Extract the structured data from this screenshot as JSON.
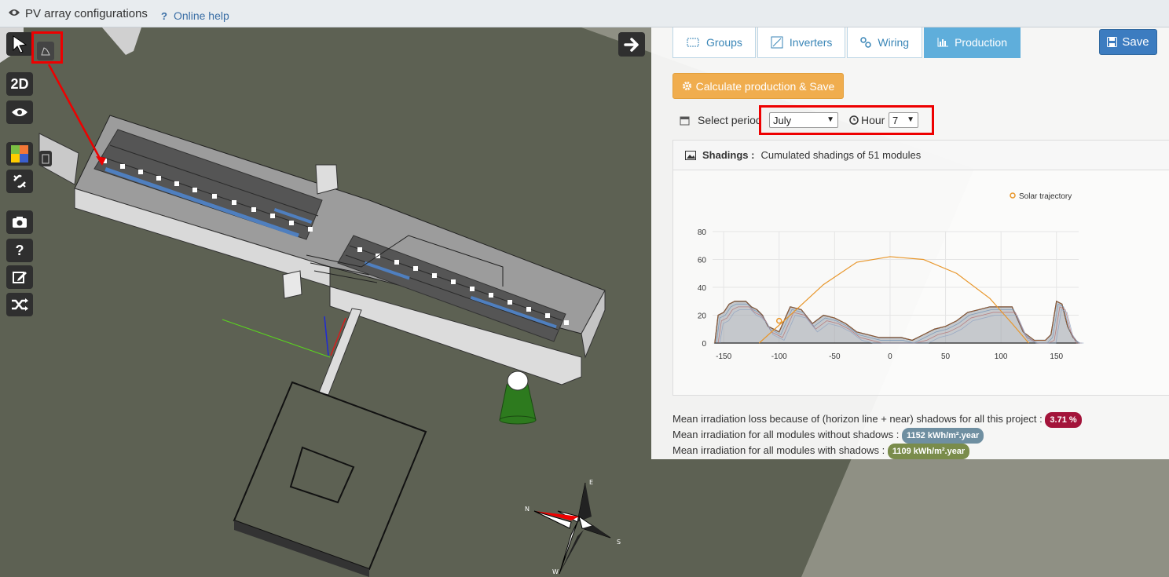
{
  "topbar": {
    "title": "PV array configurations",
    "help": "Online help"
  },
  "toolbar": {
    "mode_2d": "2D",
    "help_q": "?"
  },
  "tabs": [
    {
      "label": "Groups",
      "icon": "groups-icon"
    },
    {
      "label": "Inverters",
      "icon": "inverter-icon"
    },
    {
      "label": "Wiring",
      "icon": "wiring-icon"
    },
    {
      "label": "Production",
      "icon": "bar-chart-icon",
      "active": true
    }
  ],
  "save_label": "Save",
  "calc_label": "Calculate production & Save",
  "period": {
    "label": "Select period",
    "month": "July",
    "hour_label": "Hour",
    "hour": "7"
  },
  "shadings": {
    "title": "Shadings :",
    "subtitle": "Cumulated shadings of 51 modules"
  },
  "chart_data": {
    "type": "area",
    "series": [
      {
        "name": "Solar trajectory",
        "color": "#e8962a"
      }
    ],
    "solar_trajectory": {
      "x": [
        -118,
        -90,
        -60,
        -30,
        0,
        30,
        60,
        90,
        110,
        125
      ],
      "y": [
        0,
        20,
        42,
        58,
        62,
        60,
        50,
        32,
        14,
        0
      ]
    },
    "horizon": {
      "x": [
        -158,
        -155,
        -150,
        -145,
        -140,
        -130,
        -125,
        -120,
        -115,
        -110,
        -100,
        -90,
        -80,
        -70,
        -60,
        -50,
        -40,
        -30,
        -20,
        -10,
        0,
        10,
        20,
        30,
        40,
        50,
        60,
        70,
        80,
        90,
        100,
        110,
        120,
        130,
        140,
        145,
        150,
        155,
        160,
        165,
        170
      ],
      "y": [
        0,
        20,
        22,
        28,
        30,
        30,
        26,
        24,
        20,
        12,
        8,
        26,
        24,
        14,
        20,
        18,
        14,
        8,
        6,
        4,
        4,
        4,
        2,
        6,
        10,
        12,
        16,
        22,
        24,
        26,
        26,
        26,
        8,
        2,
        2,
        6,
        30,
        28,
        12,
        4,
        0
      ]
    },
    "xlim": [
      -160,
      170
    ],
    "ylim": [
      0,
      80
    ],
    "xticks": [
      "-150",
      "-100",
      "-50",
      "0",
      "50",
      "100",
      "150"
    ],
    "yticks": [
      "0",
      "20",
      "40",
      "60",
      "80"
    ]
  },
  "stats": {
    "loss_label": "Mean irradiation loss because of (horizon line + near) shadows for all this project :",
    "loss_value": "3.71 %",
    "without_label": "Mean irradiation for all modules without shadows :",
    "without_value": "1152 kWh/m².year",
    "with_label": "Mean irradiation for all modules with shadows :",
    "with_value": "1109 kWh/m².year"
  },
  "compass": {
    "n": "N",
    "e": "E",
    "s": "S",
    "w": "W"
  }
}
